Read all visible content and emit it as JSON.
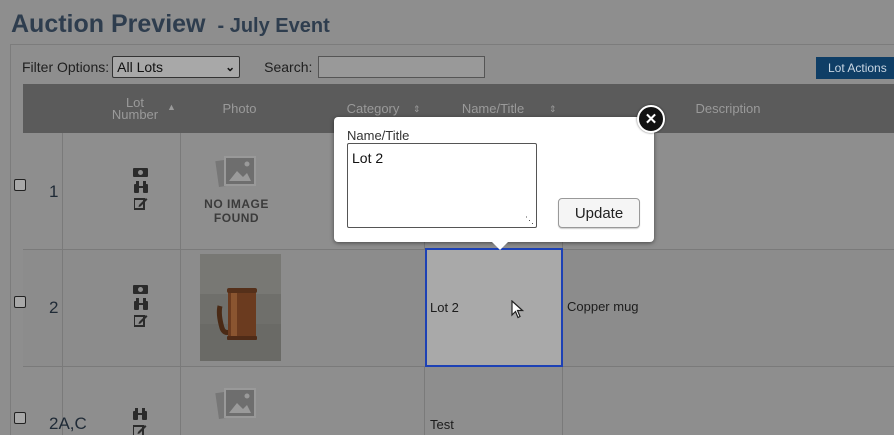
{
  "header": {
    "title": "Auction Preview",
    "subtitle": "- July Event"
  },
  "filters": {
    "filter_label": "Filter Options:",
    "filter_value": "All Lots",
    "search_label": "Search:",
    "search_value": ""
  },
  "toolbar": {
    "lot_actions_label": "Lot Actions"
  },
  "table": {
    "columns": {
      "lot_number_line1": "Lot",
      "lot_number_line2": "Number",
      "photo": "Photo",
      "category": "Category",
      "name_title": "Name/Title",
      "description": "Description"
    },
    "rows": [
      {
        "lot": "1",
        "photo": "no-image",
        "no_image_line1": "NO IMAGE",
        "no_image_line2": "FOUND",
        "name": "",
        "description": ""
      },
      {
        "lot": "2",
        "photo": "copper-mug-photo",
        "name": "Lot 2",
        "description": "Copper mug"
      },
      {
        "lot": "2A,C",
        "photo": "no-image",
        "name": "Test",
        "description": ""
      }
    ]
  },
  "popup": {
    "label": "Name/Title",
    "value": "Lot 2",
    "update_label": "Update"
  },
  "colors": {
    "accent_button": "#0f3e66",
    "selection_border": "#1d41b5",
    "overlay_gray": "#8e8e8e"
  }
}
